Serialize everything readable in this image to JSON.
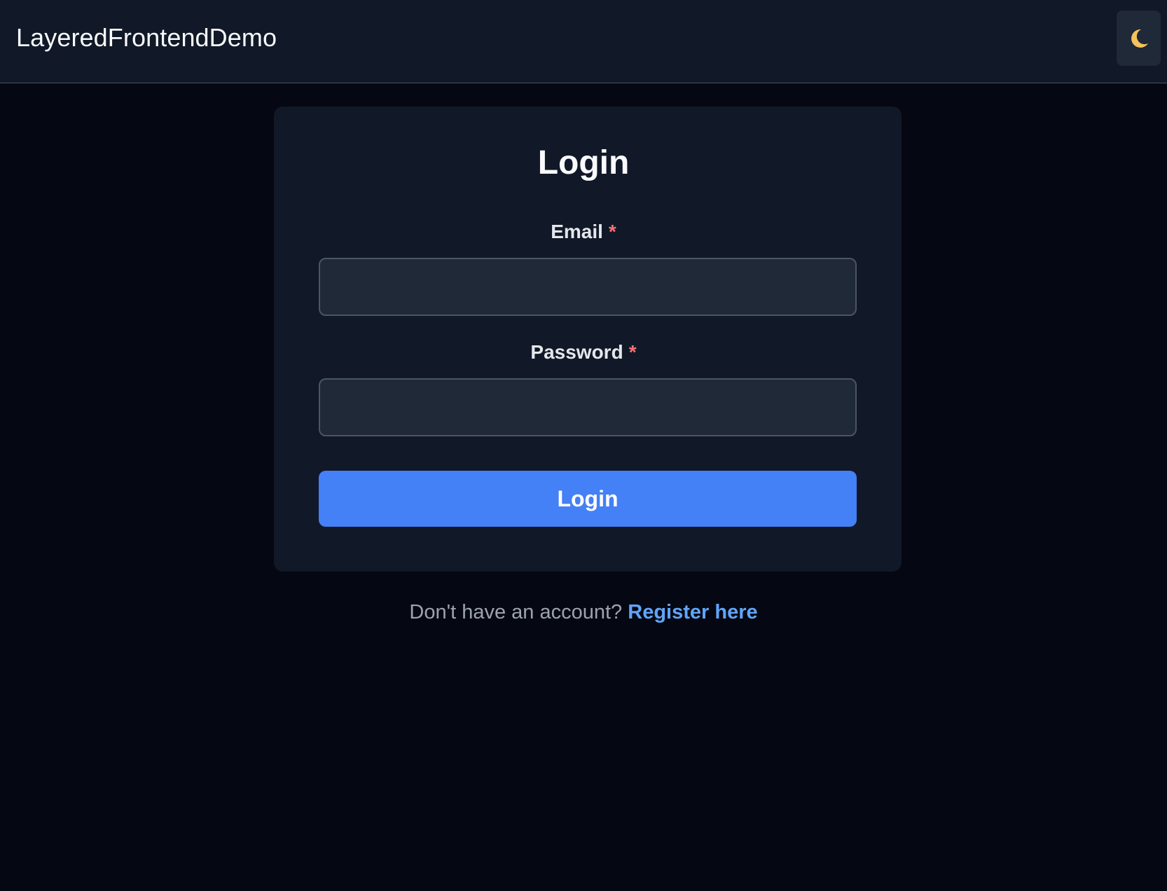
{
  "header": {
    "brand": "LayeredFrontendDemo",
    "theme_toggle_icon": "moon-icon"
  },
  "login": {
    "title": "Login",
    "email_label": "Email",
    "password_label": "Password",
    "required_marker": "*",
    "email_value": "",
    "password_value": "",
    "submit_label": "Login"
  },
  "footer": {
    "prompt": "Don't have an account?",
    "register_link": "Register here"
  },
  "colors": {
    "page_background": "#050812",
    "panel_background": "#111827",
    "input_background": "#1f2937",
    "primary_button": "#4480f6",
    "link": "#60a5fa",
    "required_marker": "#f87171"
  }
}
